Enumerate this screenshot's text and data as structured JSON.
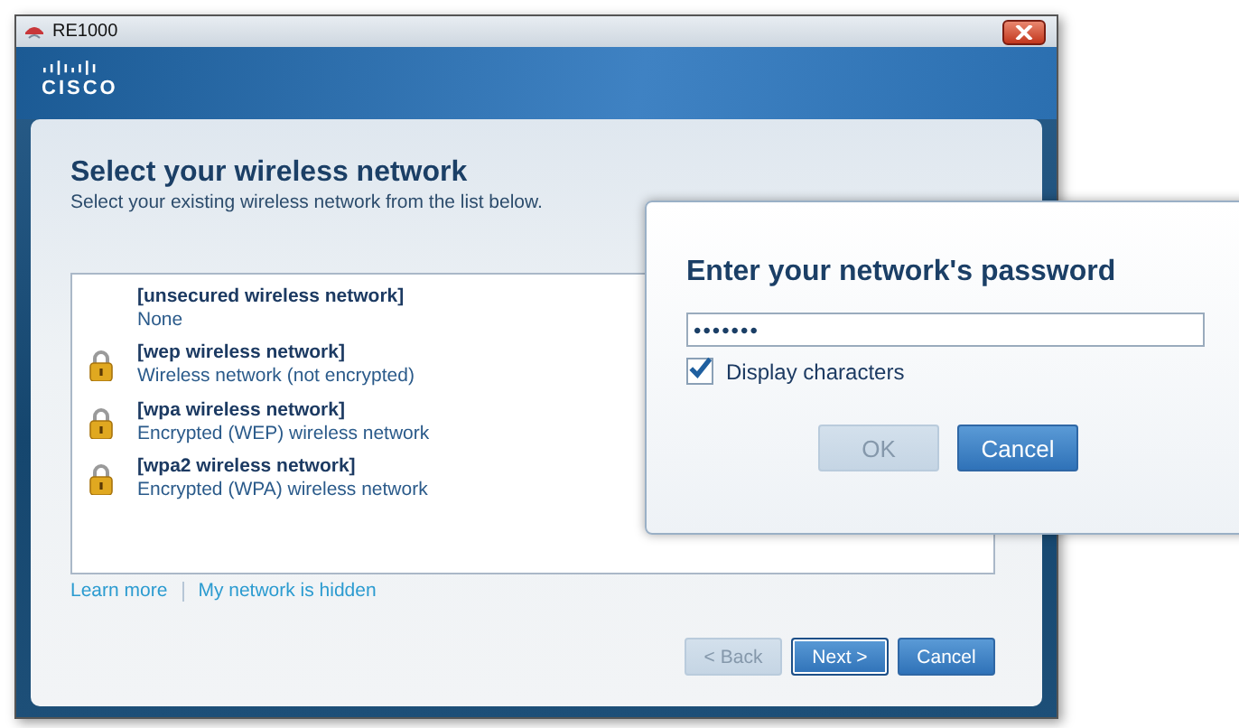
{
  "window": {
    "title": "RE1000",
    "logo": "CISCO"
  },
  "page": {
    "heading": "Select your wireless network",
    "subheading": "Select your existing wireless network from the list below."
  },
  "networks": [
    {
      "name": "[unsecured wireless network]",
      "description": "None",
      "secured": false
    },
    {
      "name": "[wep wireless network]",
      "description": "Wireless network (not encrypted)",
      "secured": true
    },
    {
      "name": "[wpa wireless network]",
      "description": "Encrypted (WEP) wireless network",
      "secured": true
    },
    {
      "name": "[wpa2 wireless network]",
      "description": "Encrypted (WPA) wireless network",
      "secured": true
    }
  ],
  "links": [
    "Learn more",
    "My network is hidden"
  ],
  "buttons": [
    {
      "label": "< Back",
      "disabled": true,
      "default": false
    },
    {
      "label": "Next >",
      "disabled": false,
      "default": true
    },
    {
      "label": "Cancel",
      "disabled": false,
      "default": false
    }
  ],
  "dialog": {
    "title": "Enter your network's password",
    "password": "•••••••",
    "display_characters": {
      "label": "Display characters",
      "checked": true
    },
    "buttons": [
      {
        "label": "OK",
        "disabled": true
      },
      {
        "label": "Cancel",
        "disabled": false
      }
    ]
  }
}
